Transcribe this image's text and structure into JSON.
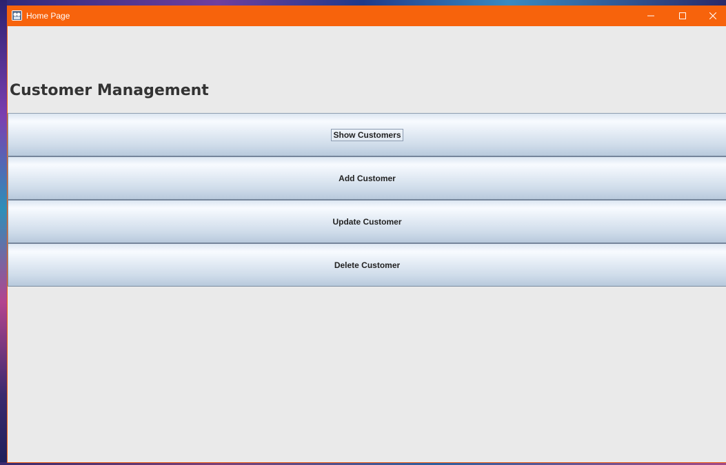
{
  "window": {
    "title": "Home Page",
    "accent_color": "#f7630c",
    "icon": "java-app-icon",
    "controls": {
      "minimize": "—",
      "maximize": "☐",
      "close": "✕"
    }
  },
  "main": {
    "heading": "Customer Management",
    "buttons": [
      {
        "label": "Show Customers",
        "focused": true
      },
      {
        "label": "Add Customer",
        "focused": false
      },
      {
        "label": "Update Customer",
        "focused": false
      },
      {
        "label": "Delete Customer",
        "focused": false
      }
    ]
  }
}
